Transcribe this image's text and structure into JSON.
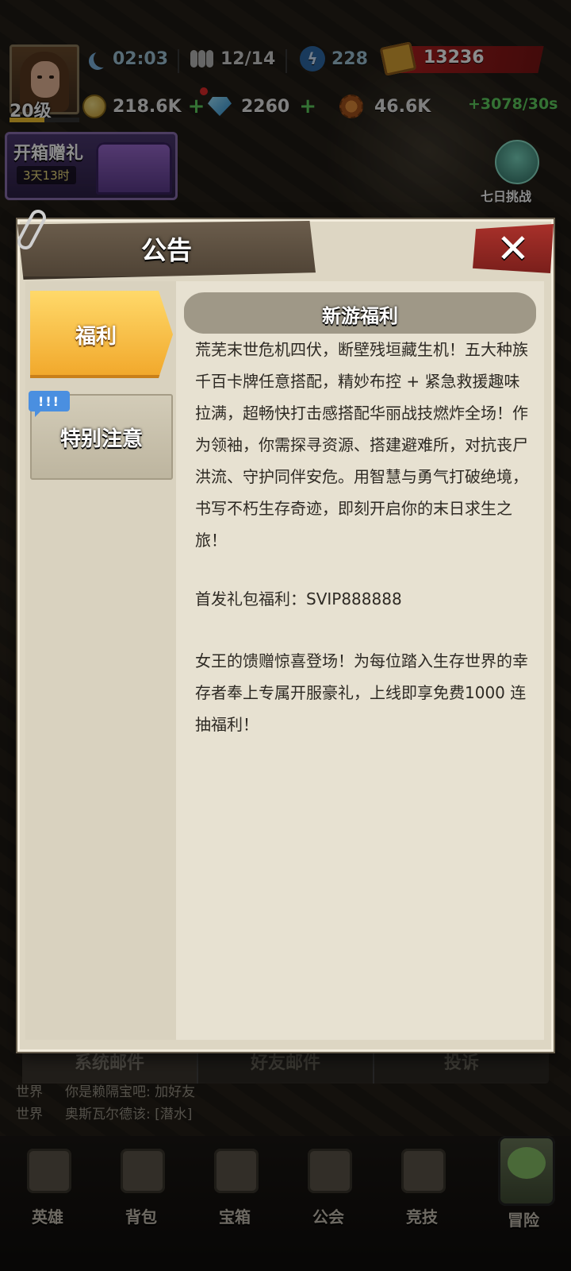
{
  "hud": {
    "time": "02:03",
    "population": "12/14",
    "energy": "228",
    "tickets": "13236",
    "level": "20级",
    "level_progress": 0.5,
    "gold": "218.6K",
    "gems": "2260",
    "caps": "46.6K",
    "rate": "+3078/30s"
  },
  "events": {
    "gift_title": "开箱赠礼",
    "gift_time": "3天13时",
    "seven_day": "七日挑战"
  },
  "dialog": {
    "title": "公告",
    "close": "✕",
    "tabs": [
      {
        "label": "福利"
      },
      {
        "label": "特别注意",
        "badge": "!!!"
      }
    ],
    "content_title": "新游福利",
    "paragraphs": [
      "荒芜末世危机四伏，断壁残垣藏生机！五大种族千百卡牌任意搭配，精妙布控 + 紧急救援趣味拉满，超畅快打击感搭配华丽战技燃炸全场！作为领袖，你需探寻资源、搭建避难所，对抗丧尸洪流、守护同伴安危。用智慧与勇气打破绝境，书写不朽生存奇迹，即刻开启你的末日求生之旅！",
      "首发礼包福利：SVIP888888",
      "女王的馈赠惊喜登场！为每位踏入生存世界的幸存者奉上专属开服豪礼，上线即享免费1000 连抽福利！"
    ]
  },
  "mail_tabs": [
    "系统邮件",
    "好友邮件",
    "投诉"
  ],
  "chat": [
    {
      "channel": "世界",
      "text": "你是赖隔宝吧: 加好友"
    },
    {
      "channel": "世界",
      "text": "奥斯瓦尔德该: [潜水]"
    }
  ],
  "nav": [
    "英雄",
    "背包",
    "宝箱",
    "公会",
    "竞技",
    "冒险"
  ]
}
